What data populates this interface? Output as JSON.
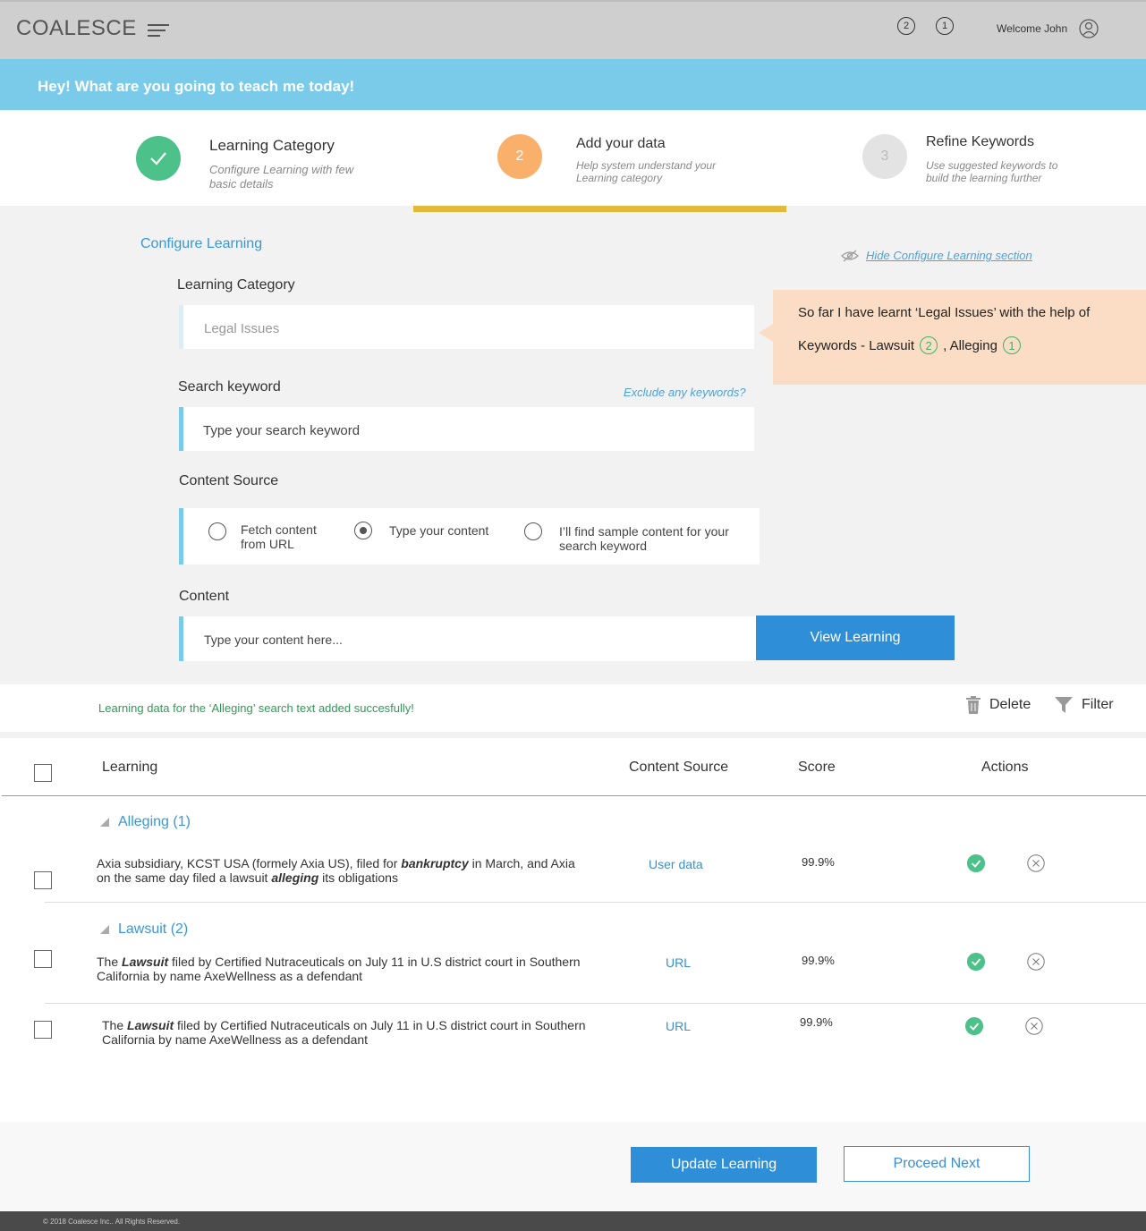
{
  "header": {
    "logo": "COALESCE",
    "notifications": [
      "2",
      "1"
    ],
    "welcome": "Welcome John"
  },
  "banner": {
    "text": "Hey! What are you going to teach me today!"
  },
  "steps": [
    {
      "number": "",
      "title": "Learning Category",
      "desc_line1": "Configure Learning with few",
      "desc_line2": "basic details",
      "state": "done",
      "color": "#4cc28a"
    },
    {
      "number": "2",
      "title": "Add your data",
      "desc_line1": "Help system understand your",
      "desc_line2": "Learning category",
      "state": "active",
      "color": "#f9b06b"
    },
    {
      "number": "3",
      "title": "Refine Keywords",
      "desc_line1": "Use suggested keywords to",
      "desc_line2": "build the learning further",
      "state": "pending",
      "color": "#e3e3e3"
    }
  ],
  "config": {
    "title": "Configure Learning",
    "hide_link": "Hide Configure Learning section",
    "category_label": "Learning Category",
    "category_value": "Legal Issues",
    "search_label": "Search keyword",
    "exclude_link": "Exclude any keywords?",
    "search_placeholder": "Type your search keyword",
    "source_label": "Content Source",
    "source_options": [
      {
        "line1": "Fetch content",
        "line2": "from URL",
        "checked": false
      },
      {
        "line1": "Type your content",
        "line2": "",
        "checked": true
      },
      {
        "line1": "I’ll find sample content for your",
        "line2": "search keyword",
        "checked": false
      }
    ],
    "content_label": "Content",
    "content_placeholder": "Type your content here...",
    "view_button": "View Learning"
  },
  "tooltip": {
    "line1": "So far I have learnt ‘Legal Issues’ with the help of",
    "prefix": "Keywords - Lawsuit",
    "badge1": "2",
    "sep": ", Alleging",
    "badge2": "1"
  },
  "status": {
    "message": "Learning data for the ‘Alleging’ search text added succesfully!",
    "delete": "Delete",
    "filter": "Filter"
  },
  "table": {
    "headers": {
      "learning": "Learning",
      "source": "Content Source",
      "score": "Score",
      "actions": "Actions"
    },
    "groups": [
      {
        "label": "Alleging (1)"
      },
      {
        "label": "Lawsuit (2)"
      }
    ],
    "rows": [
      {
        "t1": "Axia subsidiary, KCST USA (formely Axia US), filed for ",
        "b1": "bankruptcy",
        "t2": " in March, and Axia on the same day filed a lawsuit ",
        "b2": "alleging",
        "t3": " its obligations",
        "source": "User data",
        "score": "99.9%"
      },
      {
        "t1": "The ",
        "b1": "Lawsuit",
        "t2": " filed by Certified Nutraceuticals on July 11 in U.S district court in Southern California by name AxeWellness as a defendant",
        "b2": "",
        "t3": "",
        "source": "URL",
        "score": "99.9%"
      },
      {
        "t1": "The ",
        "b1": "Lawsuit",
        "t2": " filed by Certified Nutraceuticals on July 11 in U.S district court in Southern California by name AxeWellness as a defendant",
        "b2": "",
        "t3": "",
        "source": "URL",
        "score": "99.9%"
      }
    ]
  },
  "buttons": {
    "update": "Update Learning",
    "proceed": "Proceed Next"
  },
  "footer": {
    "text": "© 2018 Coalesce Inc.. All Rights Reserved."
  },
  "icons": [
    "menu-icon",
    "user-icon",
    "check-icon",
    "eye-slash-icon",
    "trash-icon",
    "filter-icon",
    "collapse-triangle-icon",
    "approve-icon",
    "reject-icon"
  ]
}
